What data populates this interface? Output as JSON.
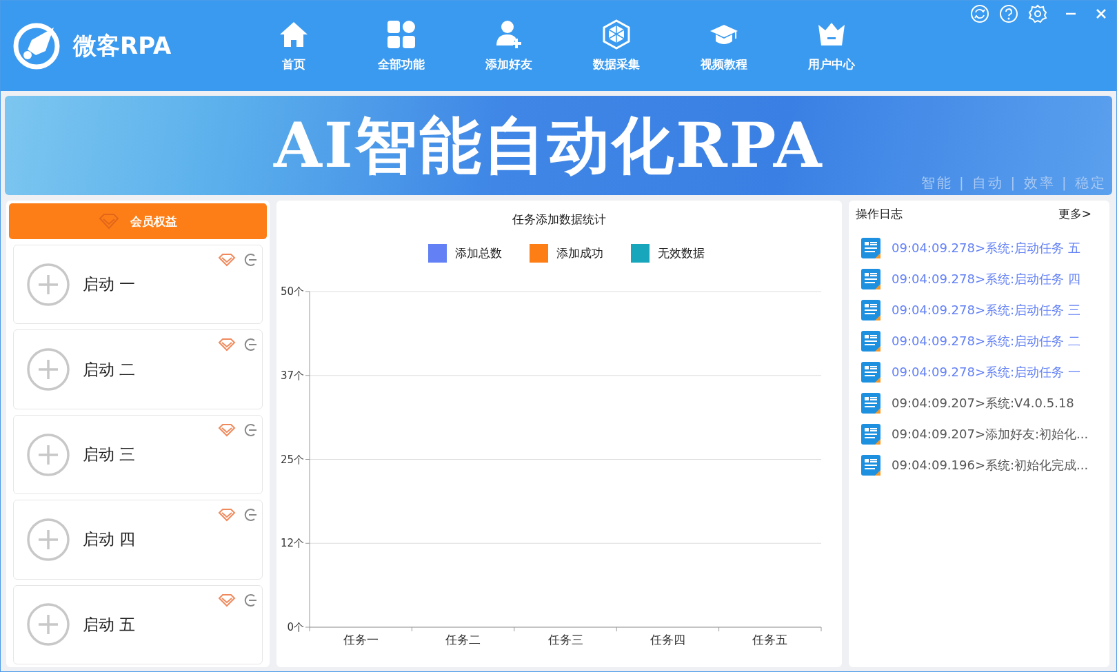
{
  "app": {
    "title": "微客RPA"
  },
  "nav": [
    {
      "label": "首页"
    },
    {
      "label": "全部功能"
    },
    {
      "label": "添加好友"
    },
    {
      "label": "数据采集"
    },
    {
      "label": "视频教程"
    },
    {
      "label": "用户中心"
    }
  ],
  "banner": {
    "headline": "AI智能自动化RPA",
    "tagline": "智能 | 自动 | 效率 | 稳定"
  },
  "member_button": "会员权益",
  "tasks": [
    {
      "label": "启动 一"
    },
    {
      "label": "启动 二"
    },
    {
      "label": "启动 三"
    },
    {
      "label": "启动 四"
    },
    {
      "label": "启动 五"
    }
  ],
  "chart": {
    "chart_data": {
      "type": "bar",
      "title": "任务添加数据统计",
      "categories": [
        "任务一",
        "任务二",
        "任务三",
        "任务四",
        "任务五"
      ],
      "series": [
        {
          "name": "添加总数",
          "color": "#6381f5",
          "values": [
            0,
            0,
            0,
            0,
            0
          ]
        },
        {
          "name": "添加成功",
          "color": "#fd7e14",
          "values": [
            0,
            0,
            0,
            0,
            0
          ]
        },
        {
          "name": "无效数据",
          "color": "#17a6bb",
          "values": [
            0,
            0,
            0,
            0,
            0
          ]
        }
      ],
      "ylim": [
        0,
        50
      ],
      "grid": true,
      "yticks": [
        {
          "value": 0,
          "label": "0个"
        },
        {
          "value": 12.5,
          "label": "12个"
        },
        {
          "value": 25,
          "label": "25个"
        },
        {
          "value": 37.5,
          "label": "37个"
        },
        {
          "value": 50,
          "label": "50个"
        }
      ]
    }
  },
  "log": {
    "title": "操作日志",
    "more": "更多>",
    "entries": [
      {
        "text": "09:04:09.278>系统:启动任务 五",
        "color": "#6381f5"
      },
      {
        "text": "09:04:09.278>系统:启动任务 四",
        "color": "#6381f5"
      },
      {
        "text": "09:04:09.278>系统:启动任务 三",
        "color": "#6381f5"
      },
      {
        "text": "09:04:09.278>系统:启动任务 二",
        "color": "#6381f5"
      },
      {
        "text": "09:04:09.278>系统:启动任务 一",
        "color": "#6381f5"
      },
      {
        "text": "09:04:09.207>系统:V4.0.5.18",
        "color": "#555555"
      },
      {
        "text": "09:04:09.207>添加好友:初始化...",
        "color": "#555555"
      },
      {
        "text": "09:04:09.196>系统:初始化完成...",
        "color": "#555555"
      }
    ]
  }
}
